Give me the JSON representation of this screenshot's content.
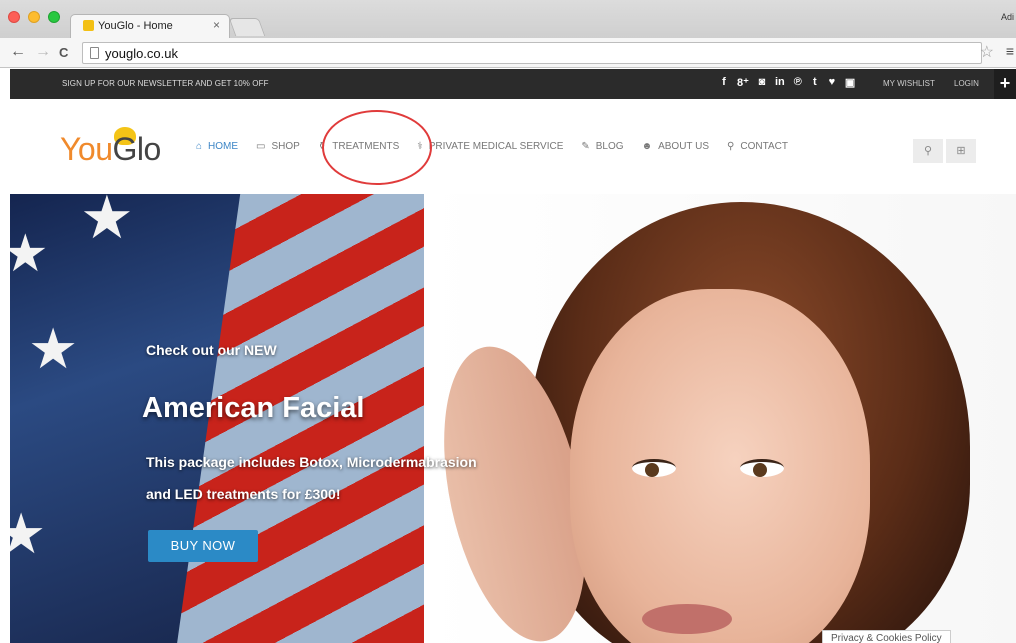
{
  "browser": {
    "tab_title": "YouGlo - Home",
    "tab_close": "×",
    "url": "youglo.co.uk",
    "corner_text": "Adi"
  },
  "topbar": {
    "promo": "SIGN UP FOR OUR NEWSLETTER AND GET 10% OFF",
    "social": [
      {
        "glyph": "f",
        "icon": "facebook-icon"
      },
      {
        "glyph": "8⁺",
        "icon": "google-plus-icon"
      },
      {
        "glyph": "◙",
        "icon": "instagram-icon"
      },
      {
        "glyph": "in",
        "icon": "linkedin-icon"
      },
      {
        "glyph": "℗",
        "icon": "pinterest-icon"
      },
      {
        "glyph": "t",
        "icon": "tumblr-icon"
      },
      {
        "glyph": "♥",
        "icon": "twitter-icon"
      },
      {
        "glyph": "▣",
        "icon": "youtube-icon"
      }
    ],
    "wishlist": "MY WISHLIST",
    "login": "LOGIN",
    "plus": "+"
  },
  "header": {
    "logo_you": "You",
    "logo_glo": "Glo",
    "nav": [
      {
        "label": "HOME",
        "icon": "⌂",
        "name": "home",
        "active": true
      },
      {
        "label": "SHOP",
        "icon": "▭",
        "name": "shop",
        "active": false
      },
      {
        "label": "TREATMENTS",
        "icon": "⚱",
        "name": "treatments",
        "active": false
      },
      {
        "label": "PRIVATE MEDICAL SERVICE",
        "icon": "⚕",
        "name": "private-medical-service",
        "active": false
      },
      {
        "label": "BLOG",
        "icon": "✎",
        "name": "blog",
        "active": false
      },
      {
        "label": "ABOUT US",
        "icon": "☻",
        "name": "about-us",
        "active": false
      },
      {
        "label": "CONTACT",
        "icon": "⚲",
        "name": "contact",
        "active": false
      }
    ],
    "search_glyph": "🔍︎",
    "cart_glyph": "⊞"
  },
  "hero": {
    "kicker": "Check out our NEW",
    "title": "American Facial",
    "desc_line1": "This package includes Botox, Microdermabrasion",
    "desc_line2": "and LED treatments for £300!",
    "button": "BUY NOW"
  },
  "footer": {
    "cookie": "Privacy & Cookies Policy"
  },
  "colors": {
    "accent": "#3d86c6",
    "topbar": "#2b2b2b",
    "button": "#2b8ac6",
    "logo": "#f08a2c",
    "ring": "#e03b3b"
  }
}
